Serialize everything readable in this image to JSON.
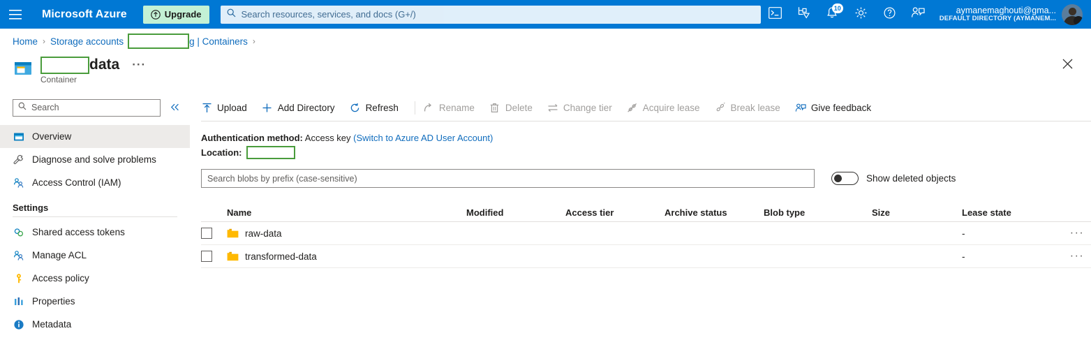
{
  "topbar": {
    "menu_icon": "hamburger-icon",
    "brand": "Microsoft Azure",
    "upgrade_label": "Upgrade",
    "upgrade_icon": "upgrade-arrow-icon",
    "upgrade_bg": "#c3f1d5",
    "search_placeholder": "Search resources, services, and docs (G+/)",
    "search_icon": "search-icon",
    "icons": [
      {
        "name": "cloud-shell-icon"
      },
      {
        "name": "directories-subscriptions-icon"
      },
      {
        "name": "notifications-bell-icon",
        "badge": "10"
      },
      {
        "name": "settings-gear-icon"
      },
      {
        "name": "help-question-icon"
      },
      {
        "name": "feedback-person-icon"
      }
    ],
    "account_name": "aymanemaghouti@gma...",
    "account_directory": "DEFAULT DIRECTORY (AYMANEM...",
    "bar_color": "#0078d4"
  },
  "breadcrumb": {
    "items": [
      {
        "label": "Home",
        "type": "link"
      },
      {
        "label": "Storage accounts",
        "type": "link"
      },
      {
        "label": "",
        "type": "redacted",
        "width": 88
      },
      {
        "label": "g | Containers",
        "type": "link"
      }
    ],
    "separator": "›"
  },
  "page_header": {
    "icon": "container-icon",
    "redacted_prefix_width": 70,
    "title": "data",
    "subtitle": "Container",
    "more_label": "···",
    "close_icon": "close-icon"
  },
  "sidebar": {
    "search_placeholder": "Search",
    "search_icon": "search-icon",
    "collapse_icon": "chevron-double-left-icon",
    "items": [
      {
        "label": "Overview",
        "icon": "overview-icon",
        "selected": true
      },
      {
        "label": "Diagnose and solve problems",
        "icon": "wrench-icon",
        "selected": false
      },
      {
        "label": "Access Control (IAM)",
        "icon": "people-icon",
        "selected": false
      }
    ],
    "group_title": "Settings",
    "settings_items": [
      {
        "label": "Shared access tokens",
        "icon": "link-rings-icon"
      },
      {
        "label": "Manage ACL",
        "icon": "people-icon"
      },
      {
        "label": "Access policy",
        "icon": "key-icon"
      },
      {
        "label": "Properties",
        "icon": "properties-bars-icon"
      },
      {
        "label": "Metadata",
        "icon": "info-circle-icon"
      }
    ]
  },
  "toolbar": {
    "buttons": [
      {
        "label": "Upload",
        "icon": "upload-arrow-icon",
        "disabled": false
      },
      {
        "label": "Add Directory",
        "icon": "plus-icon",
        "disabled": false
      },
      {
        "label": "Refresh",
        "icon": "refresh-icon",
        "disabled": false
      },
      {
        "label": "Rename",
        "icon": "rename-arrow-icon",
        "disabled": true
      },
      {
        "label": "Delete",
        "icon": "trash-icon",
        "disabled": true
      },
      {
        "label": "Change tier",
        "icon": "change-tier-arrows-icon",
        "disabled": true
      },
      {
        "label": "Acquire lease",
        "icon": "lease-icon",
        "disabled": true
      },
      {
        "label": "Break lease",
        "icon": "break-lease-icon",
        "disabled": true
      },
      {
        "label": "Give feedback",
        "icon": "feedback-person-icon",
        "disabled": false
      }
    ],
    "separator_after_index": 2
  },
  "info": {
    "auth_label": "Authentication method:",
    "auth_value": "Access key",
    "auth_link": "(Switch to Azure AD User Account)",
    "location_label": "Location:",
    "location_redacted_width": 70
  },
  "filter": {
    "blob_search_placeholder": "Search blobs by prefix (case-sensitive)",
    "toggle_label": "Show deleted objects",
    "toggle_on": false
  },
  "table": {
    "columns": [
      "Name",
      "Modified",
      "Access tier",
      "Archive status",
      "Blob type",
      "Size",
      "Lease state"
    ],
    "rows": [
      {
        "name": "raw-data",
        "icon": "folder-icon",
        "modified": "",
        "access_tier": "",
        "archive_status": "",
        "blob_type": "",
        "size": "",
        "lease_state": "-",
        "menu": "···"
      },
      {
        "name": "transformed-data",
        "icon": "folder-icon",
        "modified": "",
        "access_tier": "",
        "archive_status": "",
        "blob_type": "",
        "size": "",
        "lease_state": "-",
        "menu": "···"
      }
    ]
  },
  "colors": {
    "azure_blue": "#0078d4",
    "link_blue": "#0f6cbd",
    "redaction_border": "#4a9c3c",
    "folder_yellow": "#ffb900",
    "selected_row": "#edebe9"
  }
}
